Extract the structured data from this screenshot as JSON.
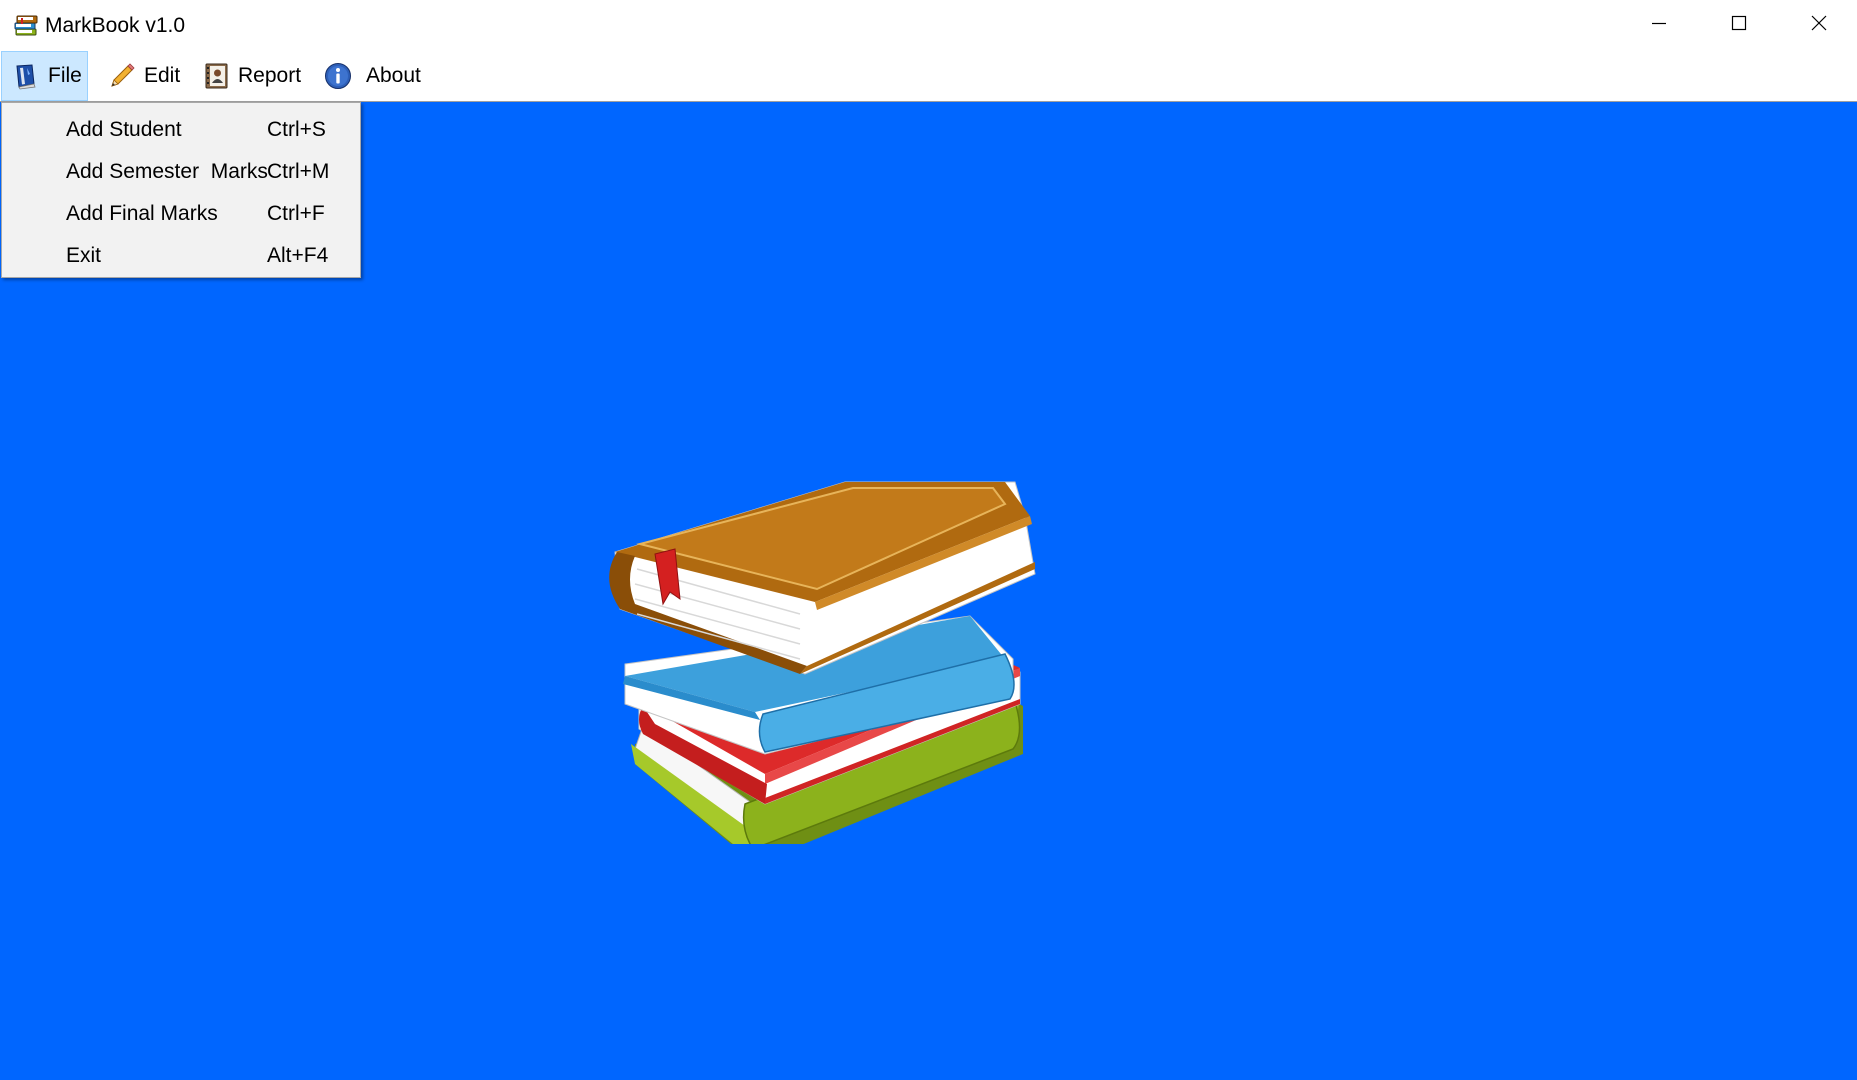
{
  "window": {
    "title": "MarkBook v1.0",
    "icon": "books-icon"
  },
  "titlebar_buttons": {
    "minimize": "minimize-icon",
    "maximize": "maximize-icon",
    "close": "close-icon"
  },
  "menubar": {
    "items": [
      {
        "label": "File",
        "icon": "book-icon",
        "open": true
      },
      {
        "label": "Edit",
        "icon": "pencil-icon"
      },
      {
        "label": "Report",
        "icon": "report-icon"
      },
      {
        "label": "About",
        "icon": "info-icon"
      }
    ]
  },
  "file_menu": {
    "items": [
      {
        "label": "Add Student",
        "shortcut": "Ctrl+S"
      },
      {
        "label": "Add Semester  Marks",
        "shortcut": "Ctrl+M"
      },
      {
        "label": "Add Final Marks",
        "shortcut": "Ctrl+F"
      },
      {
        "label": "Exit",
        "shortcut": "Alt+F4"
      }
    ]
  },
  "colors": {
    "background": "#0066ff",
    "menu_highlight": "#cce8ff",
    "menu_highlight_border": "#99d1ff",
    "dropdown_bg": "#f2f2f2"
  },
  "illustration": "stack-of-books"
}
